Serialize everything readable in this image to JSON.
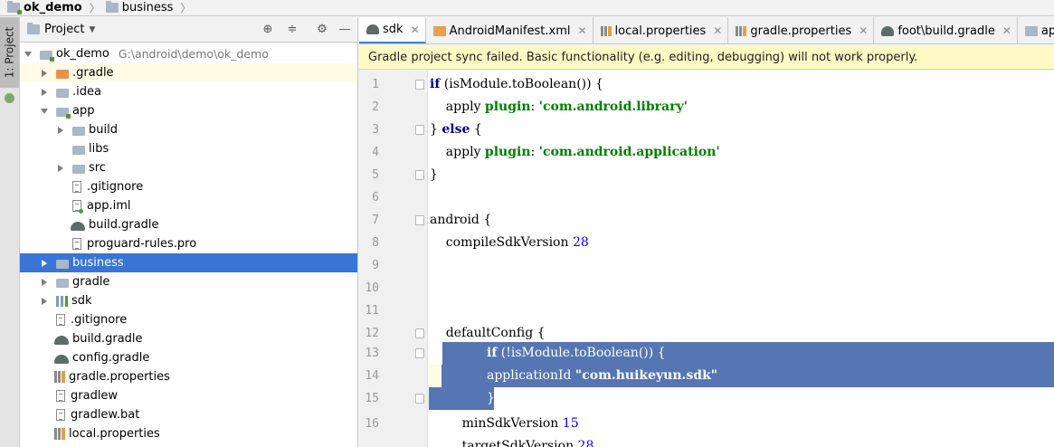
{
  "breadcrumb": {
    "root": "ok_demo",
    "child": "business"
  },
  "left_stripe": {
    "project_tab": "1: Project"
  },
  "project_panel": {
    "view_mode": "Project",
    "tree": [
      {
        "label": "ok_demo",
        "hint": "G:\\android\\demo\\ok_demo"
      },
      {
        "label": ".gradle"
      },
      {
        "label": ".idea"
      },
      {
        "label": "app"
      },
      {
        "label": "build"
      },
      {
        "label": "libs"
      },
      {
        "label": "src"
      },
      {
        "label": ".gitignore"
      },
      {
        "label": "app.iml"
      },
      {
        "label": "build.gradle"
      },
      {
        "label": "proguard-rules.pro"
      },
      {
        "label": "business"
      },
      {
        "label": "gradle"
      },
      {
        "label": "sdk"
      },
      {
        "label": ".gitignore"
      },
      {
        "label": "build.gradle"
      },
      {
        "label": "config.gradle"
      },
      {
        "label": "gradle.properties"
      },
      {
        "label": "gradlew"
      },
      {
        "label": "gradlew.bat"
      },
      {
        "label": "local.properties"
      }
    ]
  },
  "editor_tabs": [
    {
      "label": "sdk"
    },
    {
      "label": "AndroidManifest.xml"
    },
    {
      "label": "local.properties"
    },
    {
      "label": "gradle.properties"
    },
    {
      "label": "foot\\build.gradle"
    },
    {
      "label": "app.iml"
    }
  ],
  "banner": {
    "message": "Gradle project sync failed. Basic functionality (e.g. editing, debugging) will not work properly."
  },
  "editor": {
    "line_numbers": [
      "1",
      "2",
      "3",
      "4",
      "5",
      "6",
      "7",
      "8",
      "9",
      "10",
      "11",
      "12",
      "13",
      "14",
      "15",
      "16"
    ],
    "lines": {
      "l1_kw": "if",
      "l1_rest": " (isModule.toBoolean()) {",
      "l2_a": "    apply ",
      "l2_b": "plugin",
      "l2_c": ": ",
      "l2_d": "'com.android.library'",
      "l3_a": "} ",
      "l3_kw": "else",
      "l3_b": " {",
      "l4_a": "    apply ",
      "l4_b": "plugin",
      "l4_c": ": ",
      "l4_d": "'com.android.application'",
      "l5": "}",
      "l7": "android {",
      "l8_a": "    compileSdkVersion ",
      "l8_num": "28",
      "l12": "    defaultConfig {",
      "l13_kw": "if",
      "l13_rest": " (!isModule.toBoolean()) {",
      "l14_a": "applicationId ",
      "l14_str": "\"com.huikeyun.sdk\"",
      "l15": "}",
      "l16_a": "        minSdkVersion ",
      "l16_num": "15",
      "l17_a": "        targetSdkVersion ",
      "l17_num": "28"
    }
  }
}
